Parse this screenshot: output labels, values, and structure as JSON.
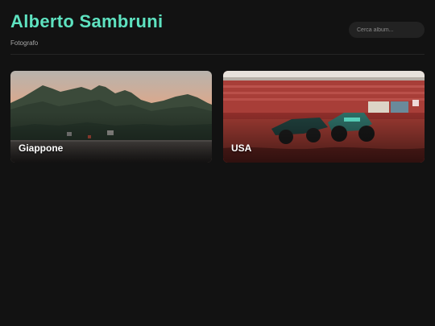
{
  "header": {
    "title": "Alberto Sambruni",
    "subtitle": "Fotografo"
  },
  "search": {
    "placeholder": "Cerca album..."
  },
  "albums": [
    {
      "label": "Giappone"
    },
    {
      "label": "USA"
    }
  ],
  "colors": {
    "background": "#121212",
    "accent": "#5ee2c0",
    "search_bg": "#222222"
  }
}
